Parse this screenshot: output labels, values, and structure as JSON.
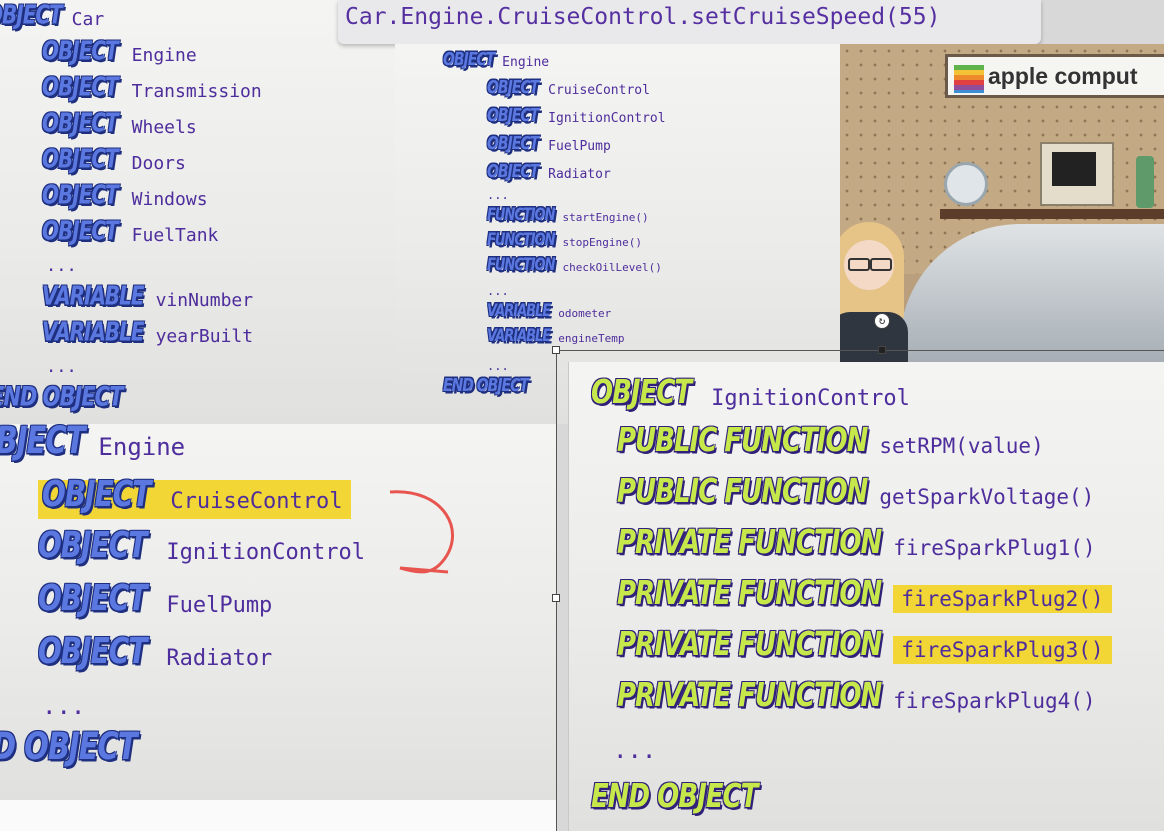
{
  "top_bar": {
    "code": "Car.Engine.CruiseControl.setCruiseSpeed(55)"
  },
  "car_panel": {
    "header_kw": "OBJECT",
    "header_name": "Car",
    "items": [
      {
        "kw": "OBJECT",
        "name": "Engine"
      },
      {
        "kw": "OBJECT",
        "name": "Transmission"
      },
      {
        "kw": "OBJECT",
        "name": "Wheels"
      },
      {
        "kw": "OBJECT",
        "name": "Doors"
      },
      {
        "kw": "OBJECT",
        "name": "Windows"
      },
      {
        "kw": "OBJECT",
        "name": "FuelTank"
      }
    ],
    "dots1": "...",
    "vars": [
      {
        "kw": "VARIABLE",
        "name": "vinNumber"
      },
      {
        "kw": "VARIABLE",
        "name": "yearBuilt"
      }
    ],
    "dots2": "...",
    "end": "END OBJECT"
  },
  "engine_small": {
    "header_kw": "OBJECT",
    "header_name": "Engine",
    "objects": [
      {
        "kw": "OBJECT",
        "name": "CruiseControl"
      },
      {
        "kw": "OBJECT",
        "name": "IgnitionControl"
      },
      {
        "kw": "OBJECT",
        "name": "FuelPump"
      },
      {
        "kw": "OBJECT",
        "name": "Radiator"
      }
    ],
    "dots1": "...",
    "functions": [
      {
        "kw": "FUNCTION",
        "name": "startEngine()"
      },
      {
        "kw": "FUNCTION",
        "name": "stopEngine()"
      },
      {
        "kw": "FUNCTION",
        "name": "checkOilLevel()"
      }
    ],
    "dots2": "...",
    "vars": [
      {
        "kw": "VARIABLE",
        "name": "odometer"
      },
      {
        "kw": "VARIABLE",
        "name": "engineTemp"
      }
    ],
    "dots3": "...",
    "end": "END OBJECT"
  },
  "scene": {
    "sign_text": "apple comput"
  },
  "engine_large": {
    "header_kw": "OBJECT",
    "header_name": "Engine",
    "objects": [
      {
        "kw": "OBJECT",
        "name": "CruiseControl",
        "highlight": true
      },
      {
        "kw": "OBJECT",
        "name": "IgnitionControl",
        "highlight": false
      },
      {
        "kw": "OBJECT",
        "name": "FuelPump",
        "highlight": false
      },
      {
        "kw": "OBJECT",
        "name": "Radiator",
        "highlight": false
      }
    ],
    "dots": "...",
    "end": "D OBJECT",
    "arrow_color": "#e8554f"
  },
  "ignition_panel": {
    "header_kw": "OBJECT",
    "header_name": "IgnitionControl",
    "functions": [
      {
        "kw": "PUBLIC FUNCTION",
        "name": "setRPM(value)",
        "highlight": false
      },
      {
        "kw": "PUBLIC FUNCTION",
        "name": "getSparkVoltage()",
        "highlight": false
      },
      {
        "kw": "PRIVATE FUNCTION",
        "name": "fireSparkPlug1()",
        "highlight": false
      },
      {
        "kw": "PRIVATE FUNCTION",
        "name": "fireSparkPlug2()",
        "highlight": true
      },
      {
        "kw": "PRIVATE FUNCTION",
        "name": "fireSparkPlug3()",
        "highlight": true
      },
      {
        "kw": "PRIVATE FUNCTION",
        "name": "fireSparkPlug4()",
        "highlight": false
      }
    ],
    "dots": "...",
    "end": "END OBJECT"
  },
  "colors": {
    "keyword_blue": "#5a78e0",
    "keyword_green": "#c6e84a",
    "name_purple": "#4e2d9c",
    "highlight_yellow": "#f2d635"
  }
}
